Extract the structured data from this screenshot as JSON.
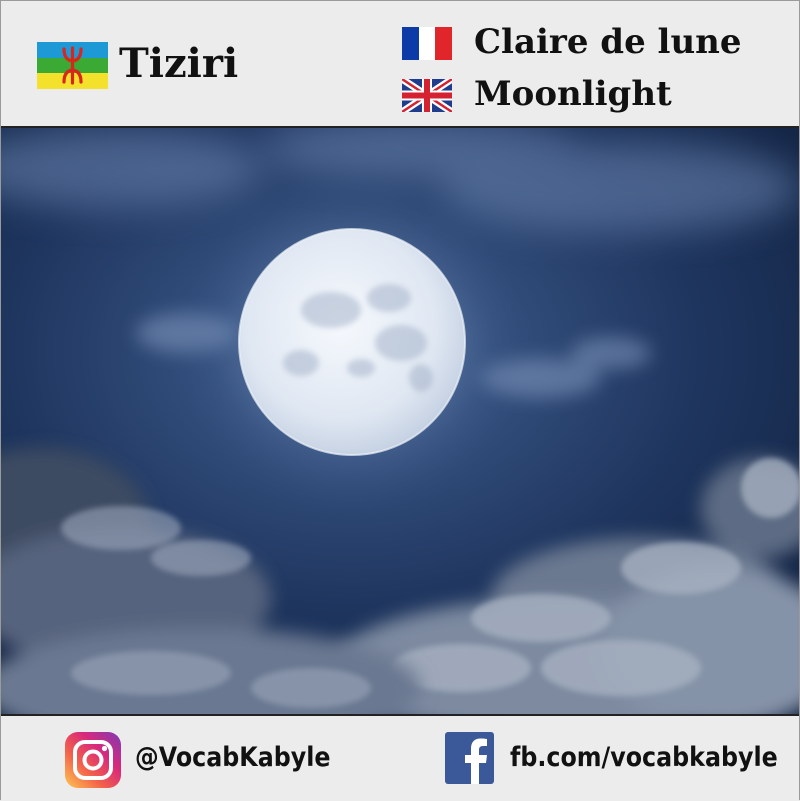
{
  "header": {
    "kabyle": {
      "word": "Tiziri",
      "flag_icon": "kabyle-amazigh-flag-icon"
    },
    "french": {
      "word": "Claire de lune",
      "flag_icon": "france-flag-icon"
    },
    "english": {
      "word": "Moonlight",
      "flag_icon": "uk-flag-icon"
    }
  },
  "image": {
    "subject": "full-moon-night-sky-photo"
  },
  "footer": {
    "instagram": {
      "icon": "instagram-icon",
      "handle": "@VocabKabyle"
    },
    "facebook": {
      "icon": "facebook-icon",
      "handle": "fb.com/vocabkabyle"
    }
  },
  "colors": {
    "background": "#ececec",
    "border": "#222222",
    "text": "#111111",
    "sky": "#1c3258",
    "moon": "#e8eef7",
    "facebook": "#3b5998"
  }
}
